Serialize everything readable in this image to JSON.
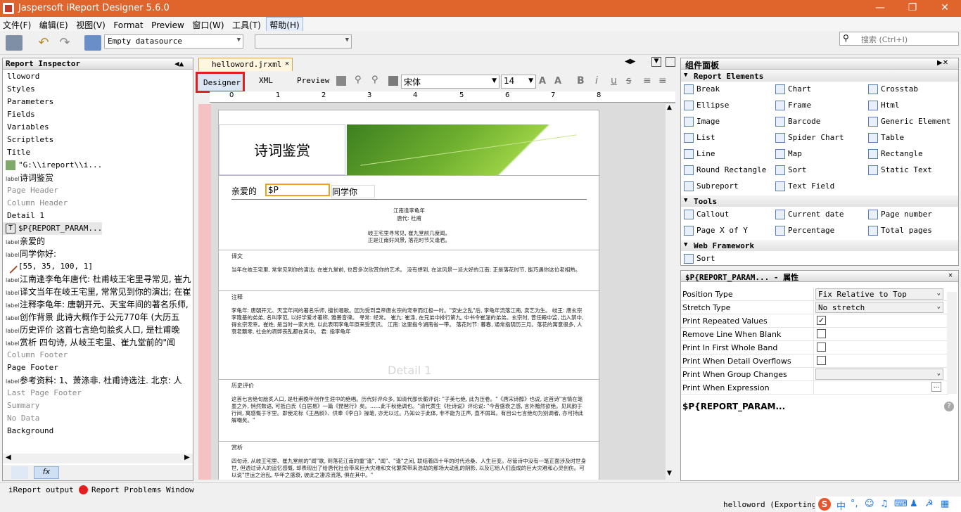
{
  "app": {
    "title": "Jaspersoft iReport Designer 5.6.0"
  },
  "menu": [
    "文件(F)",
    "编辑(E)",
    "视图(V)",
    "Format",
    "Preview",
    "窗口(W)",
    "工具(T)",
    "帮助(H)"
  ],
  "toolbar": {
    "datasource": "Empty datasource",
    "search_placeholder": "搜索 (Ctrl+I)"
  },
  "inspector": {
    "title": "Report Inspector",
    "items": [
      {
        "text": "lloword",
        "style": "plain"
      },
      {
        "text": "Styles",
        "style": "plain"
      },
      {
        "text": "Parameters",
        "style": "plain"
      },
      {
        "text": "Fields",
        "style": "plain"
      },
      {
        "text": "Variables",
        "style": "plain"
      },
      {
        "text": "Scriptlets",
        "style": "plain"
      },
      {
        "text": "Title",
        "style": "plain"
      },
      {
        "text": "\"G:\\\\ireport\\\\i...",
        "style": "img"
      },
      {
        "text": "诗词鉴赏",
        "style": "label"
      },
      {
        "text": "Page Header",
        "style": "grey"
      },
      {
        "text": "Column Header",
        "style": "grey"
      },
      {
        "text": "Detail 1",
        "style": "plain"
      },
      {
        "text": "$P{REPORT_PARAM...",
        "style": "field"
      },
      {
        "text": "亲爱的",
        "style": "label"
      },
      {
        "text": "同学你好:",
        "style": "label"
      },
      {
        "text": "[55, 35, 100, 1]",
        "style": "line"
      },
      {
        "text": "江南逢李龟年唐代: 杜甫岐王宅里寻常见, 崔九",
        "style": "label"
      },
      {
        "text": "译文当年在岐王宅里, 常常见到你的演出; 在崔",
        "style": "label"
      },
      {
        "text": "注释李龟年: 唐朝开元、天宝年间的著名乐师,",
        "style": "label"
      },
      {
        "text": "创作背景  此诗大概作于公元770年 (大历五",
        "style": "label"
      },
      {
        "text": "历史评价  这首七言绝句脍炙人口, 是杜甫晚",
        "style": "label"
      },
      {
        "text": "赏析  四句诗, 从岐王宅里、崔九堂前的\"闻",
        "style": "label"
      },
      {
        "text": "Column Footer",
        "style": "grey"
      },
      {
        "text": "Page Footer",
        "style": "plain"
      },
      {
        "text": "参考资料: 1、萧涤非. 杜甫诗选注. 北京: 人",
        "style": "label"
      },
      {
        "text": "Last Page Footer",
        "style": "grey"
      },
      {
        "text": "Summary",
        "style": "grey"
      },
      {
        "text": "No Data",
        "style": "grey"
      },
      {
        "text": "Background",
        "style": "plain"
      }
    ]
  },
  "editor": {
    "tab": "helloword.jrxml",
    "subtabs": {
      "designer": "Designer",
      "xml": "XML",
      "preview": "Preview"
    },
    "font": "宋体",
    "size": "14",
    "ruler": [
      "0",
      "1",
      "2",
      "3",
      "4",
      "5",
      "6",
      "7",
      "8"
    ],
    "title_text": "诗词鉴赏",
    "dear": "亲爱的",
    "param": "$P",
    "classmate": "同学你",
    "poem_title": "江南逢李龟年",
    "poem_author": "唐代: 杜甫",
    "poem_l1": "岐王宅里寻常见, 崔九堂前几度闻。",
    "poem_l2": "正是江南好风景, 落花时节又逢君。",
    "sec_translation": "译文",
    "translation": "当年在岐王宅里, 常常见到你的演出; 在崔九堂前, 也曾多次欣赏你的艺术。 没有想到, 在这风景一派大好的江南; 正是落花时节, 能巧遇你这位老相熟。",
    "sec_notes": "注释",
    "notes": "李龟年: 唐朝开元、天宝年间的著名乐师, 擅长唱歌。因为受到皇帝唐玄宗的宠幸而红极一时。\"安史之乱\"后, 李龟年流落江南, 卖艺为生。 岐王: 唐玄宗李隆基的弟弟, 名叫李范, 以好学爱才著称, 雅善音律。 寻常: 经常。 崔九: 崔涤, 在兄弟中排行第九, 中书令崔湜的弟弟。玄宗时, 曾任殿中监, 出入禁中, 得玄宗宠幸。崔姓, 是当时一家大姓, 以此表明李龟年原来受赏识。 江南: 这里指今湖南省一带。 落花时节: 暮春, 通常指阴历三月。落花的寓意很多, 人衰老飘零, 社会的凋弊丧乱都在其中。 君: 指李龟年",
    "sec_history": "历史评价",
    "history": "这首七言绝句脍炙人口, 是杜甫晚年创作生涯中的绝唱。历代好评众多, 如清代邵长蘅评说: \"子美七绝, 此为压卷。\"《唐宋诗醇》也说, 这首诗\"言情在笔墨之外, 悄然数语, 可抵白氏《白居易》一篇《琵琶行》矣。……此千秋绝调也。\"清代黄生《杜诗说》评论说: \"今昔盛衰之感, 言外黯然欲绝。见风韵于行间, 寓感慨于字里。即使龙标《王昌龄》、供奉《李白》操笔, 亦无以过。乃知公于此体, 非不能为正声, 直不屑耳。有目公七言绝句为别调者, 亦可持此解嘲矣。\"",
    "sec_appreciation": "赏析",
    "appreciation": "四句诗, 从岐王宅里、崔九堂前的\"闻\"歌, 到落花江南的重\"逢\", \"闻\"、\"逢\"之间, 联结着四十年的时代沧桑、人生巨变。尽管诗中没有一笔正面涉及时世身世, 但透过诗人的追忆感慨, 却表现出了给唐代社会带来巨大灾难和文化繁荣带来浩劫的那场大动乱的阴影, 以及它给人们造成的巨大灾难和心灵创伤。可以说\"世运之治乱, 华年之盛衰, 彼此之凄凉流落, 俱在其中。\"",
    "band_label": "Detail 1"
  },
  "palette": {
    "title": "组件面板",
    "cat_report": "Report Elements",
    "report_items": [
      "Break",
      "Chart",
      "Crosstab",
      "Ellipse",
      "Frame",
      "Html",
      "Image",
      "Barcode",
      "Generic Element",
      "List",
      "Spider Chart",
      "Table",
      "Line",
      "Map",
      "Rectangle",
      "Round Rectangle",
      "Sort",
      "Static Text",
      "Subreport",
      "Text Field"
    ],
    "cat_tools": "Tools",
    "tool_items": [
      "Callout",
      "Current date",
      "Page number",
      "Page X of Y",
      "Percentage",
      "Total pages"
    ],
    "cat_web": "Web Framework",
    "web_items": [
      "Sort"
    ]
  },
  "properties": {
    "title": "$P{REPORT_PARAM... - 属性",
    "rows": [
      {
        "key": "Position Type",
        "value": "Fix Relative to Top",
        "kind": "combo"
      },
      {
        "key": "Stretch Type",
        "value": "No stretch",
        "kind": "combo"
      },
      {
        "key": "Print Repeated Values",
        "value": "✓",
        "kind": "check"
      },
      {
        "key": "Remove Line When Blank",
        "value": "",
        "kind": "check"
      },
      {
        "key": "Print In First Whole Band",
        "value": "",
        "kind": "check"
      },
      {
        "key": "Print When Detail Overflows",
        "value": "",
        "kind": "check"
      },
      {
        "key": "Print When Group Changes",
        "value": "",
        "kind": "combo"
      },
      {
        "key": "Print When Expression",
        "value": "",
        "kind": "text"
      }
    ],
    "selected": "$P{REPORT_PARAM...",
    "help": "?"
  },
  "bottom": {
    "output": "iReport output",
    "problems": "Report Problems Window"
  },
  "status": {
    "text": "helloword (Exporting re"
  },
  "ime": {
    "lang": "中"
  }
}
